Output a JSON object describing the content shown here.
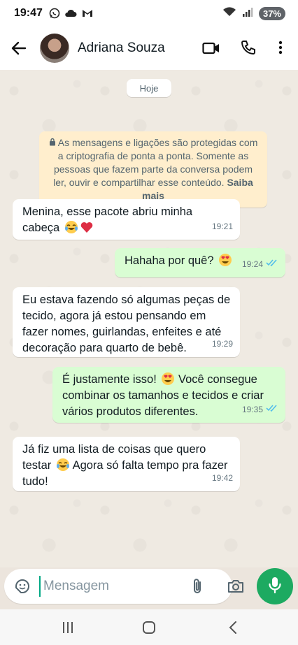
{
  "status_bar": {
    "time": "19:47",
    "battery": "37%",
    "icons_left": [
      "whatsapp-icon",
      "cloud-icon",
      "gmail-icon"
    ],
    "icons_right": [
      "wifi-icon",
      "signal-icon",
      "battery-icon"
    ]
  },
  "header": {
    "contact_name": "Adriana Souza",
    "icons": [
      "back-arrow-icon",
      "video-call-icon",
      "phone-call-icon",
      "more-options-icon"
    ]
  },
  "chat": {
    "date_chip": "Hoje",
    "encryption_notice": "As mensagens e ligações são protegidas com a criptografia de ponta a ponta. Somente as pessoas que fazem parte da conversa podem ler, ouvir e compartilhar esse conteúdo.",
    "encryption_link": "Saiba mais",
    "messages": [
      {
        "direction": "incoming",
        "text": "Menina, esse pacote abriu minha cabeça",
        "emoji": [
          "tears-of-joy",
          "red-heart"
        ],
        "time": "19:21"
      },
      {
        "direction": "outgoing",
        "text": "Hahaha por quê?",
        "emoji": [
          "heart-eyes"
        ],
        "time": "19:24",
        "read": true
      },
      {
        "direction": "incoming",
        "text": "Eu estava fazendo só algumas peças de tecido, agora já estou pensando em fazer nomes, guirlandas, enfeites e até decoração para quarto de bebê.",
        "emoji": [],
        "time": "19:29"
      },
      {
        "direction": "outgoing",
        "text_before": "É justamente isso!",
        "text_after": "Você consegue combinar os tamanhos e tecidos e criar vários produtos diferentes.",
        "emoji": [
          "heart-eyes"
        ],
        "time": "19:35",
        "read": true
      },
      {
        "direction": "incoming",
        "text_before": "Já fiz uma lista de coisas que quero testar",
        "text_after": "Agora só falta tempo pra fazer tudo!",
        "emoji": [
          "tears-of-joy"
        ],
        "time": "19:42"
      }
    ]
  },
  "input_bar": {
    "placeholder": "Mensagem",
    "value": "",
    "icons": [
      "sticker-icon",
      "attach-icon",
      "camera-icon",
      "mic-icon"
    ]
  },
  "colors": {
    "incoming_bubble": "#ffffff",
    "outgoing_bubble": "#d9fdd3",
    "accent_green": "#1daa61",
    "read_ticks": "#53bdeb",
    "encryption_bg": "#ffeecd"
  }
}
